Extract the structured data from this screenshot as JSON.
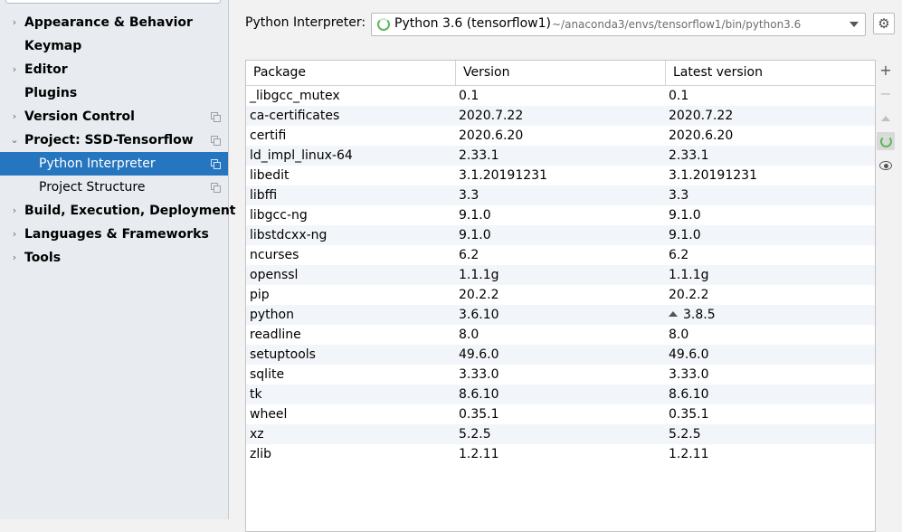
{
  "sidebar": {
    "items": [
      {
        "label": "Appearance & Behavior",
        "arrow": "›",
        "bold": true
      },
      {
        "label": "Keymap",
        "arrow": "",
        "bold": true
      },
      {
        "label": "Editor",
        "arrow": "›",
        "bold": true
      },
      {
        "label": "Plugins",
        "arrow": "",
        "bold": true
      },
      {
        "label": "Version Control",
        "arrow": "›",
        "bold": true
      },
      {
        "label": "Project: SSD-Tensorflow",
        "arrow": "⌄",
        "bold": true
      },
      {
        "label": "Python Interpreter",
        "arrow": "",
        "bold": false
      },
      {
        "label": "Project Structure",
        "arrow": "",
        "bold": false
      },
      {
        "label": "Build, Execution, Deployment",
        "arrow": "›",
        "bold": true
      },
      {
        "label": "Languages & Frameworks",
        "arrow": "›",
        "bold": true
      },
      {
        "label": "Tools",
        "arrow": "›",
        "bold": true
      }
    ]
  },
  "interpreter": {
    "label": "Python Interpreter:",
    "name": "Python 3.6 (tensorflow1)",
    "path": "~/anaconda3/envs/tensorflow1/bin/python3.6",
    "gear_icon": "⚙"
  },
  "table": {
    "columns": [
      "Package",
      "Version",
      "Latest version"
    ],
    "rows": [
      {
        "package": "_libgcc_mutex",
        "version": "0.1",
        "latest": "0.1",
        "upgrade": false
      },
      {
        "package": "ca-certificates",
        "version": "2020.7.22",
        "latest": "2020.7.22",
        "upgrade": false
      },
      {
        "package": "certifi",
        "version": "2020.6.20",
        "latest": "2020.6.20",
        "upgrade": false
      },
      {
        "package": "ld_impl_linux-64",
        "version": "2.33.1",
        "latest": "2.33.1",
        "upgrade": false
      },
      {
        "package": "libedit",
        "version": "3.1.20191231",
        "latest": "3.1.20191231",
        "upgrade": false
      },
      {
        "package": "libffi",
        "version": "3.3",
        "latest": "3.3",
        "upgrade": false
      },
      {
        "package": "libgcc-ng",
        "version": "9.1.0",
        "latest": "9.1.0",
        "upgrade": false
      },
      {
        "package": "libstdcxx-ng",
        "version": "9.1.0",
        "latest": "9.1.0",
        "upgrade": false
      },
      {
        "package": "ncurses",
        "version": "6.2",
        "latest": "6.2",
        "upgrade": false
      },
      {
        "package": "openssl",
        "version": "1.1.1g",
        "latest": "1.1.1g",
        "upgrade": false
      },
      {
        "package": "pip",
        "version": "20.2.2",
        "latest": "20.2.2",
        "upgrade": false
      },
      {
        "package": "python",
        "version": "3.6.10",
        "latest": "3.8.5",
        "upgrade": true
      },
      {
        "package": "readline",
        "version": "8.0",
        "latest": "8.0",
        "upgrade": false
      },
      {
        "package": "setuptools",
        "version": "49.6.0",
        "latest": "49.6.0",
        "upgrade": false
      },
      {
        "package": "sqlite",
        "version": "3.33.0",
        "latest": "3.33.0",
        "upgrade": false
      },
      {
        "package": "tk",
        "version": "8.6.10",
        "latest": "8.6.10",
        "upgrade": false
      },
      {
        "package": "wheel",
        "version": "0.35.1",
        "latest": "0.35.1",
        "upgrade": false
      },
      {
        "package": "xz",
        "version": "5.2.5",
        "latest": "5.2.5",
        "upgrade": false
      },
      {
        "package": "zlib",
        "version": "1.2.11",
        "latest": "1.2.11",
        "upgrade": false
      }
    ]
  },
  "toolbar": {
    "add_icon": "+",
    "remove_icon": "−"
  },
  "colors": {
    "selection": "#2675bf",
    "spinner": "#5cb85c",
    "alt_row": "#f2f5f9"
  }
}
